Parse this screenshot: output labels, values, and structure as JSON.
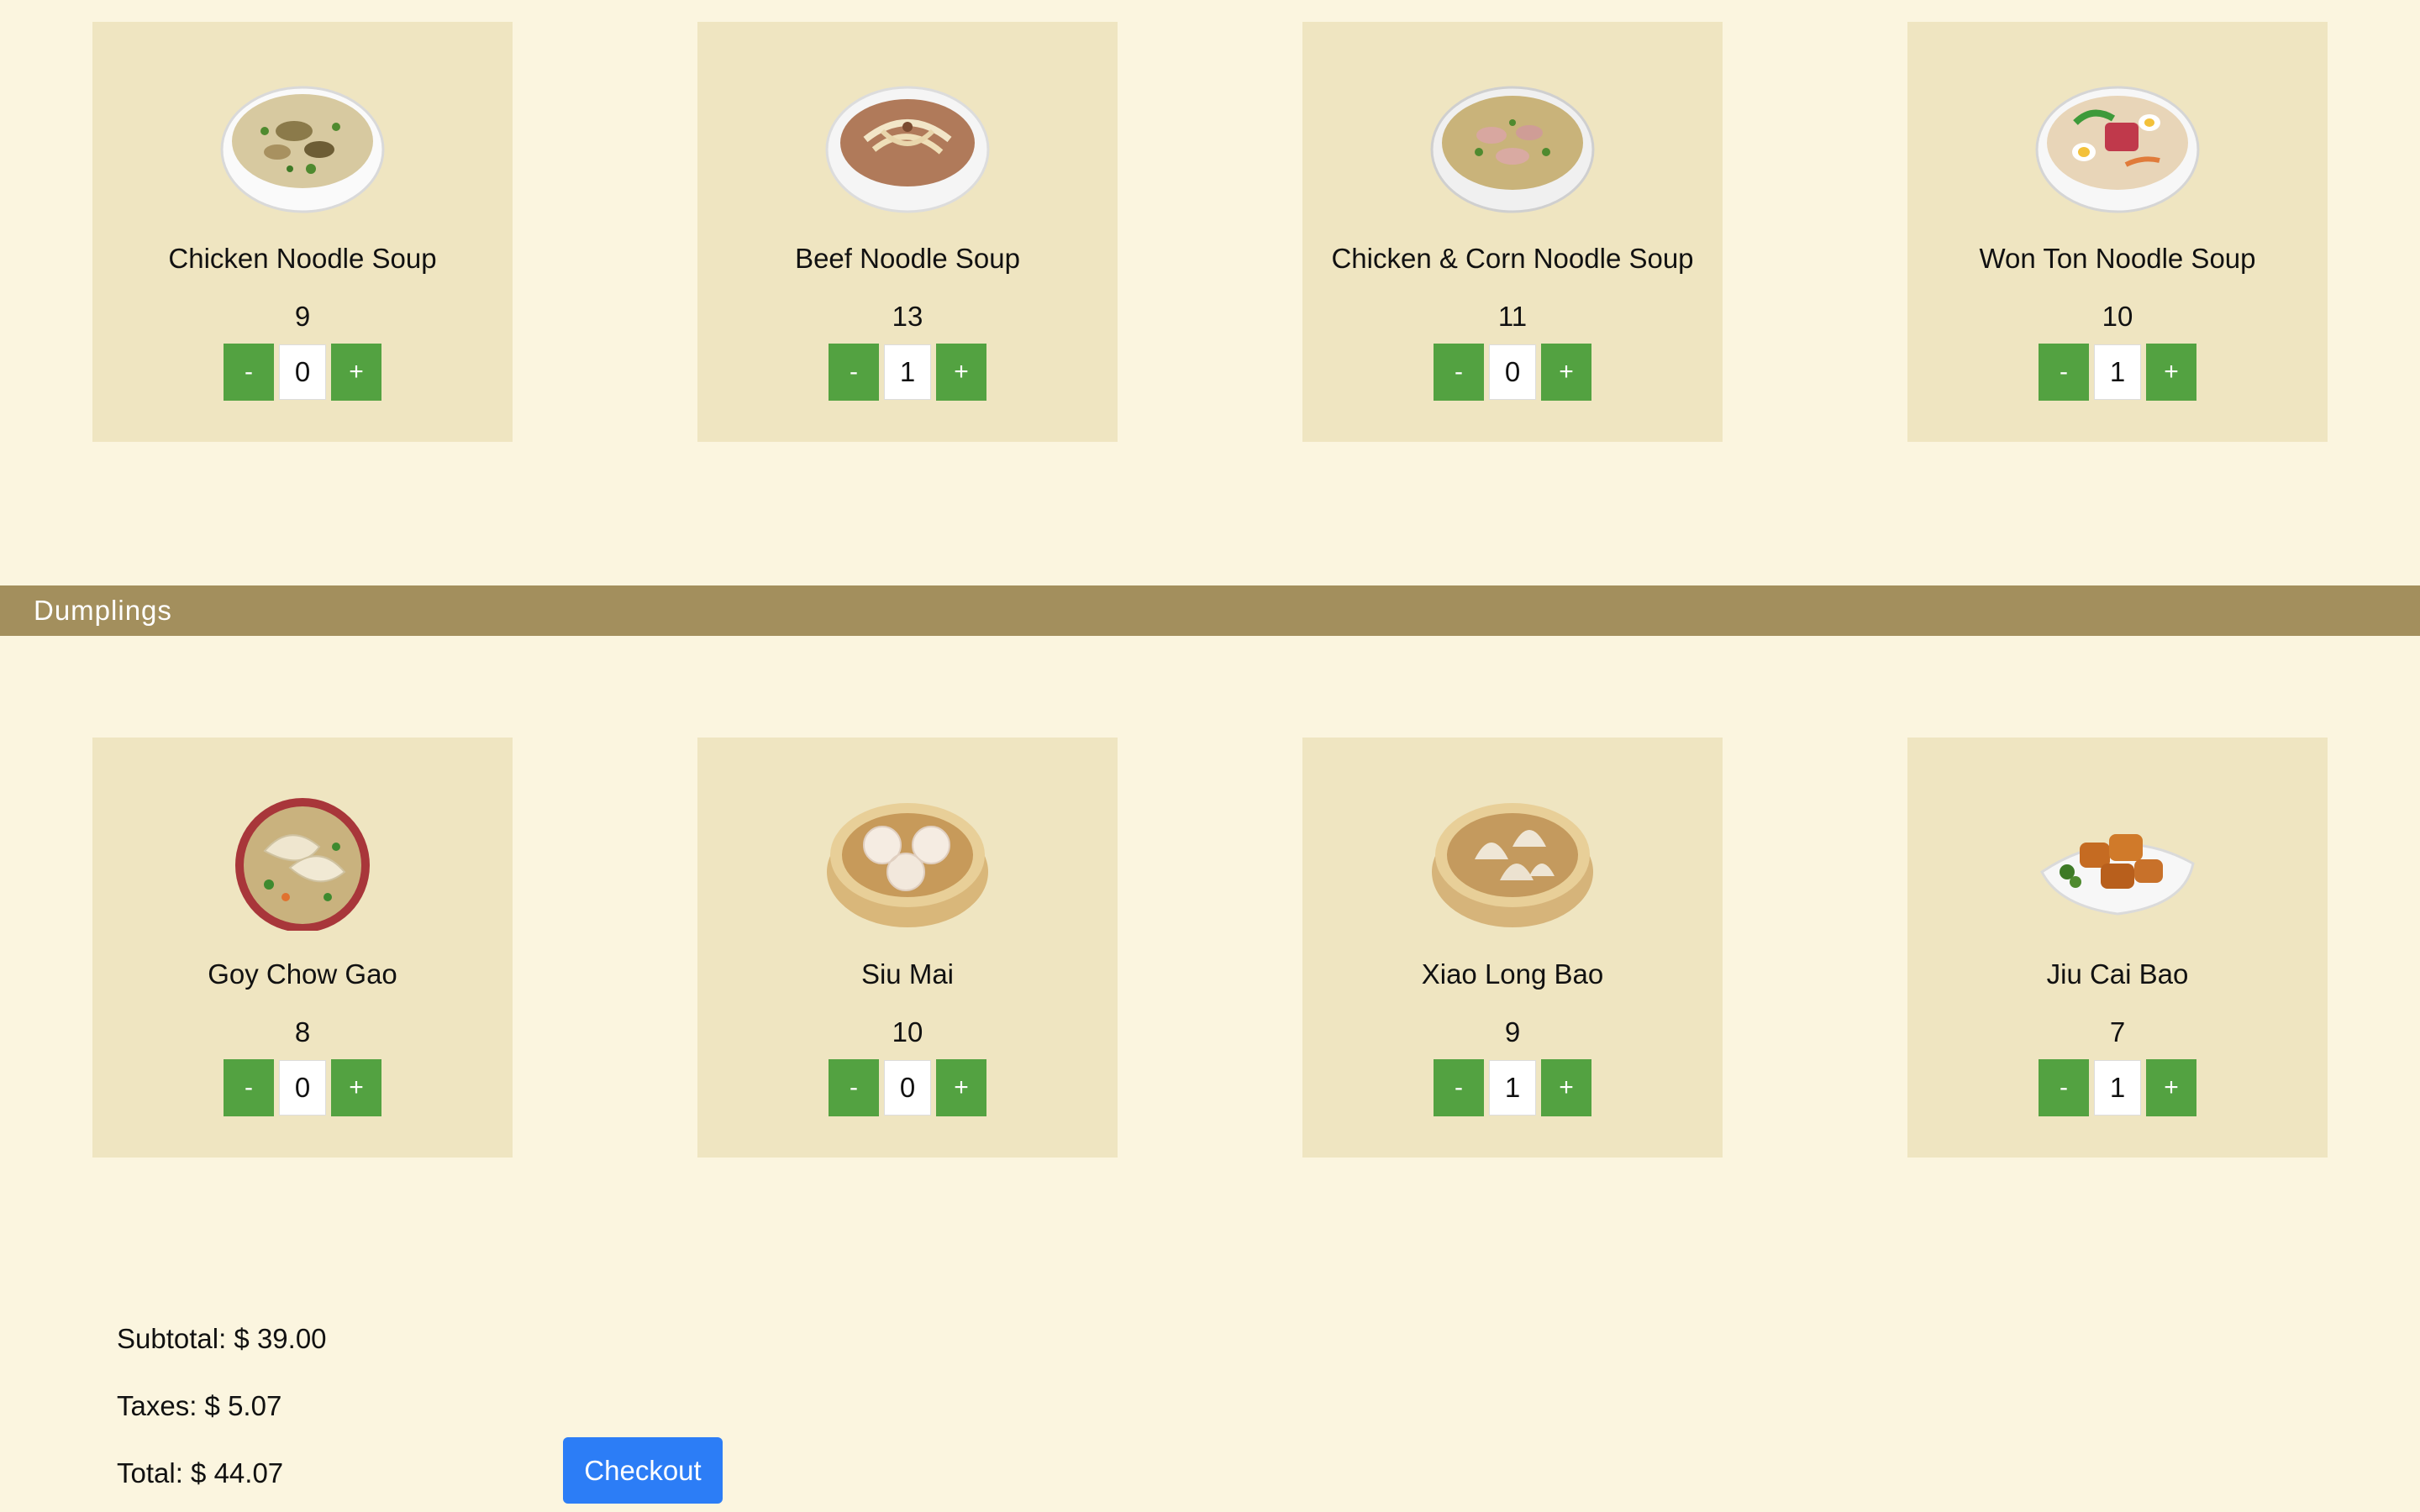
{
  "noodle_soups": [
    {
      "name": "Chicken Noodle Soup",
      "price": "9",
      "qty": "0",
      "minus_label": "-",
      "plus_label": "+",
      "image_icon": "chicken-noodle-soup-bowl-icon"
    },
    {
      "name": "Beef Noodle Soup",
      "price": "13",
      "qty": "1",
      "minus_label": "-",
      "plus_label": "+",
      "image_icon": "beef-noodle-soup-bowl-icon"
    },
    {
      "name": "Chicken & Corn Noodle Soup",
      "price": "11",
      "qty": "0",
      "minus_label": "-",
      "plus_label": "+",
      "image_icon": "chicken-corn-noodle-soup-bowl-icon"
    },
    {
      "name": "Won Ton Noodle Soup",
      "price": "10",
      "qty": "1",
      "minus_label": "-",
      "plus_label": "+",
      "image_icon": "won-ton-noodle-soup-bowl-icon"
    }
  ],
  "dumplings_section": {
    "title": "Dumplings",
    "items": [
      {
        "name": "Goy Chow Gao",
        "price": "8",
        "qty": "0",
        "minus_label": "-",
        "plus_label": "+",
        "image_icon": "goy-chow-gao-plate-icon"
      },
      {
        "name": "Siu Mai",
        "price": "10",
        "qty": "0",
        "minus_label": "-",
        "plus_label": "+",
        "image_icon": "siu-mai-steamer-icon"
      },
      {
        "name": "Xiao Long Bao",
        "price": "9",
        "qty": "1",
        "minus_label": "-",
        "plus_label": "+",
        "image_icon": "xiao-long-bao-steamer-icon"
      },
      {
        "name": "Jiu Cai Bao",
        "price": "7",
        "qty": "1",
        "minus_label": "-",
        "plus_label": "+",
        "image_icon": "jiu-cai-bao-plate-icon"
      }
    ]
  },
  "summary": {
    "subtotal": "Subtotal: $ 39.00",
    "taxes": "Taxes: $ 5.07",
    "total": "Total: $ 44.07",
    "checkout_label": "Checkout"
  },
  "colors": {
    "page_background": "#fbf5df",
    "card_background": "#efe5c1",
    "section_bar": "#a38f5d",
    "stepper_button": "#53a241",
    "checkout_button": "#2c7df6"
  }
}
